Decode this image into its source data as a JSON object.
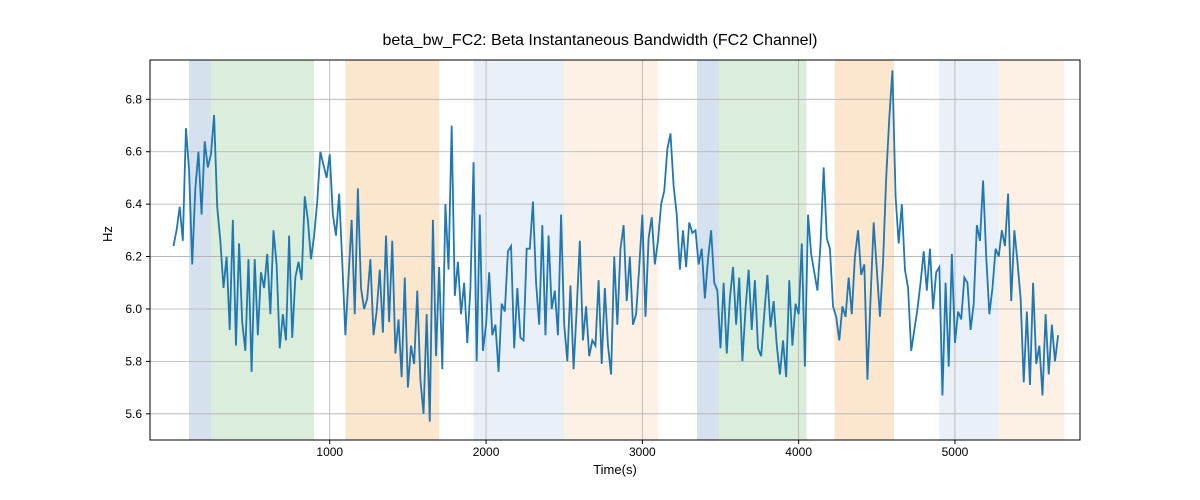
{
  "chart_data": {
    "type": "line",
    "title": "beta_bw_FC2: Beta Instantaneous Bandwidth (FC2 Channel)",
    "xlabel": "Time(s)",
    "ylabel": "Hz",
    "xlim": [
      -150,
      5800
    ],
    "ylim": [
      5.5,
      6.95
    ],
    "xticks": [
      1000,
      2000,
      3000,
      4000,
      5000
    ],
    "yticks": [
      5.6,
      5.8,
      6.0,
      6.2,
      6.4,
      6.6,
      6.8
    ],
    "background_spans": [
      {
        "x0": 100,
        "x1": 240,
        "color": "#b9cde4",
        "opacity": 0.6
      },
      {
        "x0": 240,
        "x1": 900,
        "color": "#c3e2c3",
        "opacity": 0.6
      },
      {
        "x0": 1100,
        "x1": 1700,
        "color": "#f9d5ae",
        "opacity": 0.6
      },
      {
        "x0": 1920,
        "x1": 2500,
        "color": "#d7e3f2",
        "opacity": 0.55
      },
      {
        "x0": 2500,
        "x1": 3100,
        "color": "#fbe4ce",
        "opacity": 0.55
      },
      {
        "x0": 3350,
        "x1": 3490,
        "color": "#b9cde4",
        "opacity": 0.6
      },
      {
        "x0": 3490,
        "x1": 4050,
        "color": "#c3e2c3",
        "opacity": 0.6
      },
      {
        "x0": 4230,
        "x1": 4610,
        "color": "#f9d5ae",
        "opacity": 0.6
      },
      {
        "x0": 4900,
        "x1": 5280,
        "color": "#d7e3f2",
        "opacity": 0.55
      },
      {
        "x0": 5280,
        "x1": 5700,
        "color": "#fbe4ce",
        "opacity": 0.55
      }
    ],
    "series": [
      {
        "name": "beta_bw_FC2",
        "x_step": 20,
        "x_start": 0,
        "values": [
          6.24,
          6.3,
          6.39,
          6.26,
          6.69,
          6.53,
          6.17,
          6.46,
          6.6,
          6.36,
          6.64,
          6.54,
          6.59,
          6.74,
          6.39,
          6.26,
          6.08,
          6.2,
          5.92,
          6.34,
          5.86,
          6.25,
          5.95,
          5.84,
          6.19,
          5.76,
          6.19,
          5.9,
          6.14,
          6.08,
          6.21,
          5.98,
          6.3,
          6.17,
          5.85,
          5.98,
          5.88,
          6.28,
          5.89,
          6.12,
          6.18,
          6.11,
          6.43,
          6.34,
          6.19,
          6.28,
          6.41,
          6.6,
          6.55,
          6.5,
          6.59,
          6.36,
          6.28,
          6.44,
          6.18,
          5.9,
          6.12,
          6.34,
          5.98,
          6.46,
          6.08,
          6.0,
          6.04,
          6.19,
          5.9,
          5.99,
          6.15,
          5.91,
          6.28,
          5.95,
          6.26,
          5.83,
          5.96,
          5.74,
          6.12,
          5.7,
          5.86,
          5.79,
          6.07,
          5.73,
          5.6,
          5.98,
          5.57,
          6.34,
          5.82,
          6.16,
          5.77,
          6.4,
          6.15,
          6.7,
          6.05,
          6.18,
          5.98,
          6.1,
          5.87,
          6.08,
          6.56,
          5.8,
          6.36,
          5.84,
          5.94,
          6.14,
          5.9,
          5.94,
          5.76,
          6.02,
          5.99,
          6.22,
          6.24,
          5.85,
          6.08,
          5.89,
          5.88,
          6.23,
          6.23,
          6.41,
          6.1,
          5.94,
          6.32,
          5.9,
          6.28,
          6.0,
          6.07,
          5.9,
          6.36,
          5.94,
          5.8,
          6.09,
          5.77,
          6.0,
          6.26,
          5.88,
          6.01,
          5.82,
          5.88,
          5.86,
          6.11,
          5.79,
          6.08,
          5.86,
          5.75,
          6.2,
          5.94,
          6.23,
          6.32,
          6.03,
          6.2,
          5.94,
          5.98,
          6.16,
          6.36,
          5.97,
          6.27,
          6.35,
          6.17,
          6.26,
          6.4,
          6.45,
          6.61,
          6.67,
          6.47,
          6.36,
          6.15,
          6.3,
          6.16,
          6.33,
          6.29,
          6.3,
          6.17,
          6.23,
          6.04,
          6.19,
          6.3,
          6.1,
          6.07,
          5.85,
          6.1,
          5.83,
          6.04,
          6.16,
          5.94,
          6.12,
          5.8,
          6.0,
          6.15,
          5.92,
          6.11,
          5.85,
          5.82,
          5.98,
          6.13,
          5.93,
          6.03,
          5.86,
          5.75,
          5.88,
          5.74,
          6.11,
          5.86,
          6.02,
          5.98,
          6.25,
          5.78,
          6.36,
          6.21,
          6.14,
          6.07,
          6.25,
          6.54,
          6.27,
          6.23,
          6.01,
          5.97,
          5.88,
          6.01,
          5.97,
          6.12,
          5.98,
          6.2,
          6.3,
          6.13,
          6.17,
          5.73,
          6.04,
          6.33,
          6.15,
          5.97,
          6.18,
          6.5,
          6.73,
          6.91,
          6.43,
          6.25,
          6.4,
          6.15,
          6.08,
          5.84,
          5.92,
          6.0,
          6.1,
          6.22,
          6.07,
          6.23,
          6.0,
          6.14,
          6.16,
          5.67,
          6.1,
          5.78,
          6.21,
          5.87,
          5.99,
          5.96,
          6.12,
          6.1,
          5.92,
          6.02,
          6.32,
          6.26,
          6.49,
          6.2,
          5.98,
          6.08,
          6.23,
          6.2,
          6.3,
          6.24,
          6.44,
          6.03,
          6.3,
          6.18,
          6.04,
          5.72,
          5.99,
          5.71,
          6.1,
          5.79,
          5.86,
          5.67,
          5.98,
          5.75,
          5.94,
          5.8,
          5.9
        ]
      }
    ]
  }
}
